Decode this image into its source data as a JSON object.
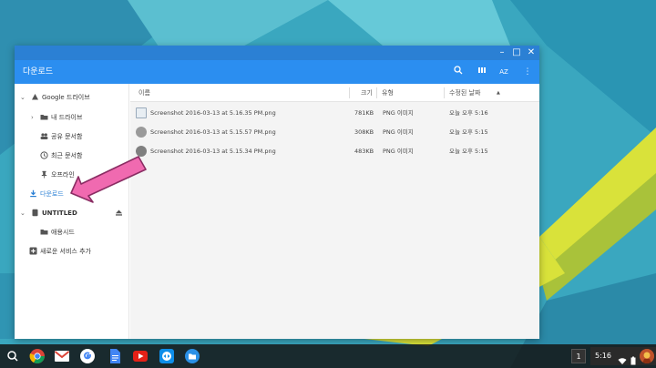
{
  "window": {
    "title": "다운로드",
    "controls": [
      "minimize-icon",
      "maximize-icon",
      "close-icon"
    ],
    "header_buttons": [
      "search-icon",
      "grid-view-icon",
      "sort-icon",
      "more-icon"
    ],
    "sort_label": "AZ"
  },
  "sidebar": {
    "items": [
      {
        "label": "Google 드라이브",
        "icon": "drive-icon"
      },
      {
        "label": "내 드라이브",
        "icon": "folder-icon"
      },
      {
        "label": "공유 문서함",
        "icon": "shared-icon"
      },
      {
        "label": "최근 문서함",
        "icon": "recent-icon"
      },
      {
        "label": "오프라인",
        "icon": "pin-icon"
      },
      {
        "label": "다운로드",
        "icon": "download-icon"
      },
      {
        "label": "UNTITLED",
        "icon": "usb-icon"
      },
      {
        "label": "애용시드",
        "icon": "folder-icon"
      },
      {
        "label": "새로운 서비스 추가",
        "icon": "add-icon"
      }
    ]
  },
  "table": {
    "headers": {
      "name": "이름",
      "size": "크기",
      "type": "유형",
      "modified": "수정된 날짜"
    },
    "sort_indicator": "▲",
    "rows": [
      {
        "name": "Screenshot 2016-03-13 at 5.16.35 PM.png",
        "size": "781KB",
        "type": "PNG 이미지",
        "modified": "오늘 오후 5:16"
      },
      {
        "name": "Screenshot 2016-03-13 at 5.15.57 PM.png",
        "size": "308KB",
        "type": "PNG 이미지",
        "modified": "오늘 오후 5:15"
      },
      {
        "name": "Screenshot 2016-03-13 at 5.15.34 PM.png",
        "size": "483KB",
        "type": "PNG 이미지",
        "modified": "오늘 오후 5:15"
      }
    ]
  },
  "shelf": {
    "apps": [
      "launcher-search-icon",
      "chrome-icon",
      "gmail-icon",
      "google-icon",
      "docs-icon",
      "youtube-icon",
      "teamviewer-icon",
      "files-icon"
    ],
    "notification_count": "1",
    "time": "5:16"
  },
  "colors": {
    "accent": "#2b8ef0",
    "titlebar": "#2b80d4",
    "arrow": "#f06ab0"
  }
}
